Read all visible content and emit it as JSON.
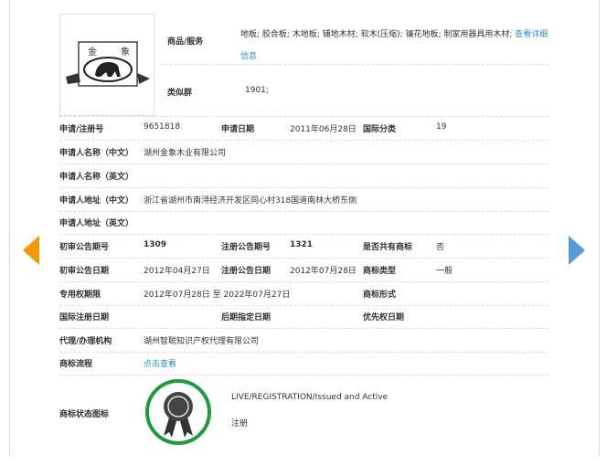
{
  "goods": {
    "label": "商品/服务",
    "text": "地板; 胶合板; 木地板; 铺地木材; 软木(压缩); 镶花地板; 制家用器具用木材;",
    "link": "查看详细信息"
  },
  "logo_text": "金 象",
  "similar": {
    "label": "类似群",
    "value": "1901;"
  },
  "rows": [
    {
      "l1": "申请/注册号",
      "v1": "9651818",
      "l2": "申请日期",
      "v2": "2011年06月28日",
      "l3": "国际分类",
      "v3": "19"
    },
    {
      "l1": "申请人名称（中文）",
      "v1": "湖州金象木业有限公司"
    },
    {
      "l1": "申请人名称（英文）",
      "v1": ""
    },
    {
      "l1": "申请人地址（中文）",
      "v1": "浙江省湖州市南浔经济开发区同心村318国道南林大桥东侧"
    },
    {
      "l1": "申请人地址（英文）",
      "v1": ""
    },
    {
      "l1": "初审公告期号",
      "v1": "1309",
      "l2": "注册公告期号",
      "v2": "1321",
      "l3": "是否共有商标",
      "v3": "否"
    },
    {
      "l1": "初审公告日期",
      "v1": "2012年04月27日",
      "l2": "注册公告日期",
      "v2": "2012年07月28日",
      "l3": "商标类型",
      "v3": "一般"
    },
    {
      "l1": "专用权期限",
      "v1": "2012年07月28日 至 2022年07月27日",
      "l3": "商标形式",
      "v3": ""
    },
    {
      "l1": "国际注册日期",
      "v1": "",
      "l2": "后期指定日期",
      "v2": "",
      "l3": "优先权日期",
      "v3": ""
    },
    {
      "l1": "代理/办理机构",
      "v1": "湖州智聪知识产权代理有限公司"
    },
    {
      "l1": "商标流程",
      "v1": "点击查看"
    }
  ],
  "status": {
    "label": "商标状态图标",
    "en": "LIVE/REGISTRATION/Issued and Active",
    "cn": "注册",
    "ring_color": "#1e9b3c"
  },
  "colors": {
    "prev_arrow": "#f39800",
    "next_arrow": "#5b9bd5",
    "link": "#2a8fd0"
  }
}
